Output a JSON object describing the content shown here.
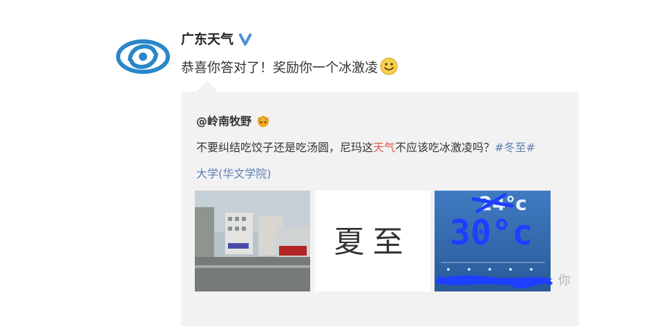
{
  "post": {
    "author": "广东天气",
    "text": "恭喜你答对了！奖励你一个冰激凌"
  },
  "repost": {
    "author": "@岭南牧野",
    "text_before": "不要纠结吃饺子还是吃汤圆，尼玛这",
    "text_highlight": "天气",
    "text_after": "不应该吃冰激凌吗？",
    "hashtag": "#冬至#",
    "line2": "大学(华文学院)"
  },
  "images": {
    "dongzhi_label": "夏至",
    "weather_old_temp": "24°c",
    "weather_new_temp": "30°c"
  },
  "watermark": "你",
  "colors": {
    "link": "#5d7fb2",
    "highlight": "#e0574d",
    "repost_bg": "#f2f2f2",
    "verified": "#4a90d9"
  }
}
